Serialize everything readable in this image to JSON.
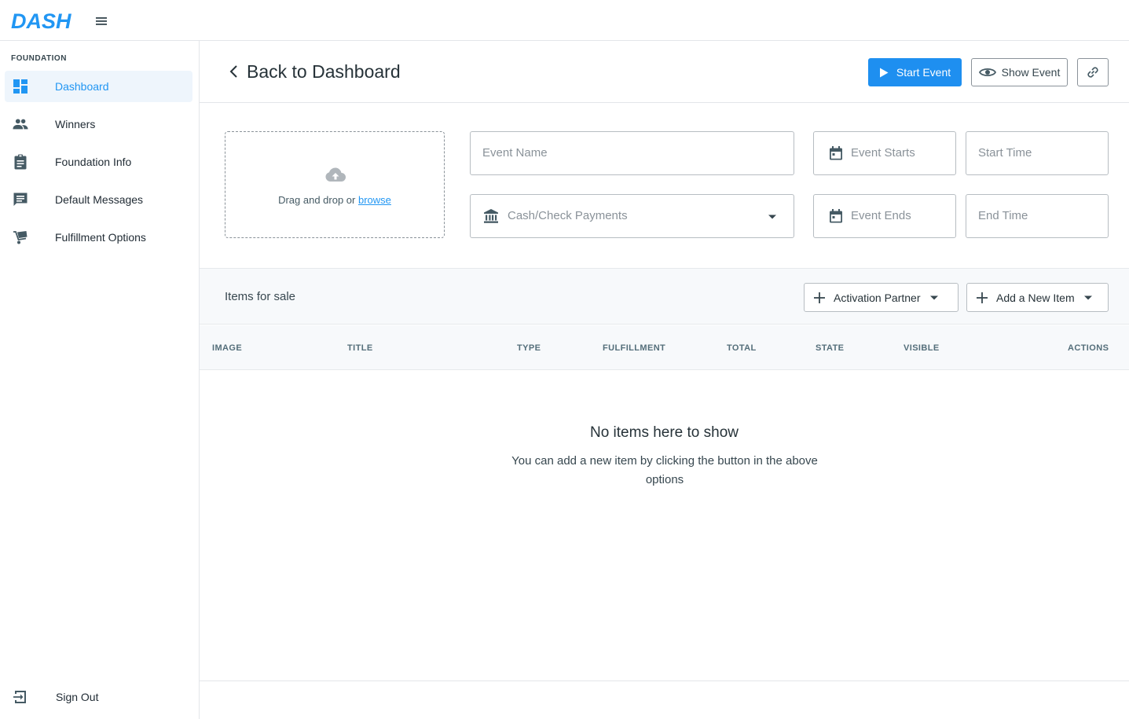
{
  "app": {
    "logo_text": "DASH",
    "brand_color": "#2196f3"
  },
  "sidebar": {
    "section_title": "FOUNDATION",
    "items": [
      {
        "label": "Dashboard",
        "icon": "dashboard-icon",
        "active": true
      },
      {
        "label": "Winners",
        "icon": "people-icon",
        "active": false
      },
      {
        "label": "Foundation Info",
        "icon": "clipboard-icon",
        "active": false
      },
      {
        "label": "Default Messages",
        "icon": "message-icon",
        "active": false
      },
      {
        "label": "Fulfillment Options",
        "icon": "cart-icon",
        "active": false
      }
    ],
    "sign_out_label": "Sign Out"
  },
  "header": {
    "back_label": "Back to Dashboard",
    "start_event_label": "Start Event",
    "show_event_label": "Show Event"
  },
  "form": {
    "upload_text": "Drag and drop or",
    "upload_link": "browse",
    "event_name_placeholder": "Event Name",
    "payment_placeholder": "Cash/Check Payments",
    "event_starts_placeholder": "Event Starts",
    "start_time_placeholder": "Start Time",
    "event_ends_placeholder": "Event Ends",
    "end_time_placeholder": "End Time"
  },
  "items": {
    "title": "Items for sale",
    "activation_partner_label": "Activation Partner",
    "add_item_label": "Add a New Item",
    "columns": [
      "IMAGE",
      "TITLE",
      "TYPE",
      "FULFILLMENT",
      "TOTAL",
      "STATE",
      "VISIBLE",
      "ACTIONS"
    ],
    "empty_title": "No items here to show",
    "empty_subtitle": "You can add a new item by clicking the button in the above options"
  }
}
